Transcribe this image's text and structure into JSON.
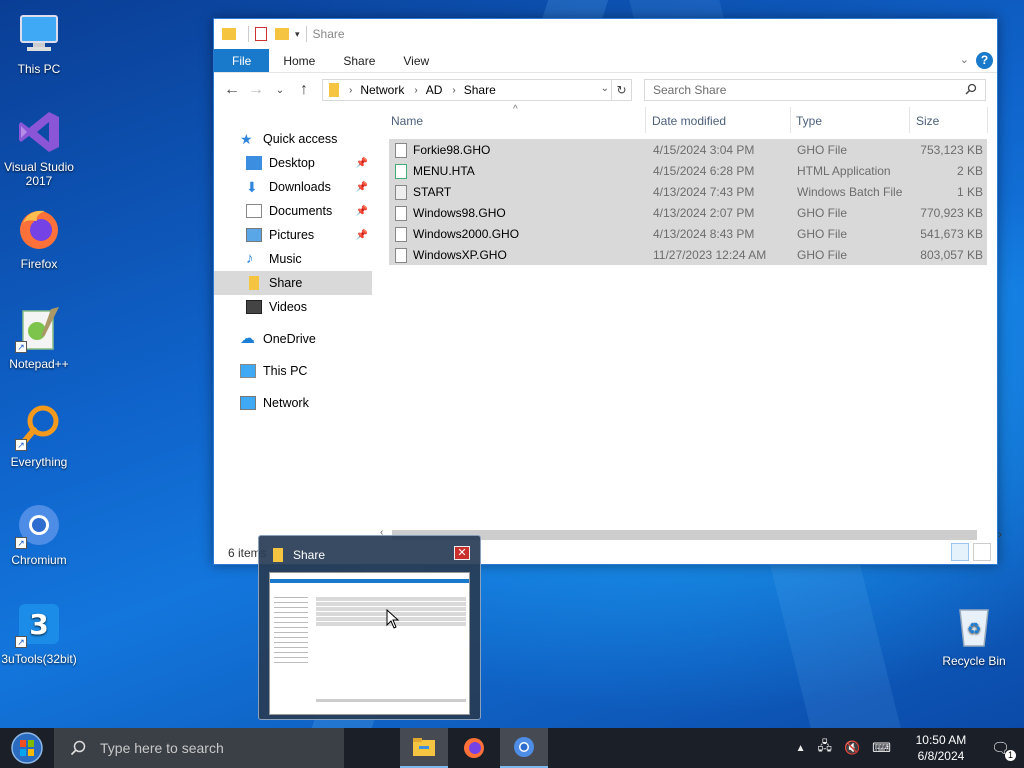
{
  "desktop": {
    "icons": [
      {
        "label": "This PC"
      },
      {
        "label": "Visual Studio 2017"
      },
      {
        "label": "Firefox"
      },
      {
        "label": "Notepad++"
      },
      {
        "label": "Everything"
      },
      {
        "label": "Chromium"
      },
      {
        "label": "3uTools(32bit)"
      },
      {
        "label": "Recycle Bin"
      }
    ]
  },
  "explorer": {
    "title": "Share",
    "ribbon_tabs": [
      "File",
      "Home",
      "Share",
      "View"
    ],
    "help": "?",
    "breadcrumbs": [
      "Network",
      "AD",
      "Share"
    ],
    "search_placeholder": "Search Share",
    "nav": {
      "quick_access": "Quick access",
      "desktop": "Desktop",
      "downloads": "Downloads",
      "documents": "Documents",
      "pictures": "Pictures",
      "music": "Music",
      "share": "Share",
      "videos": "Videos",
      "onedrive": "OneDrive",
      "this_pc": "This PC",
      "network": "Network"
    },
    "columns": {
      "name": "Name",
      "date": "Date modified",
      "type": "Type",
      "size": "Size"
    },
    "files": [
      {
        "name": "Forkie98.GHO",
        "date": "4/15/2024 3:04 PM",
        "type": "GHO File",
        "size": "753,123 KB"
      },
      {
        "name": "MENU.HTA",
        "date": "4/15/2024 6:28 PM",
        "type": "HTML Application",
        "size": "2 KB"
      },
      {
        "name": "START",
        "date": "4/13/2024 7:43 PM",
        "type": "Windows Batch File",
        "size": "1 KB"
      },
      {
        "name": "Windows98.GHO",
        "date": "4/13/2024 2:07 PM",
        "type": "GHO File",
        "size": "770,923 KB"
      },
      {
        "name": "Windows2000.GHO",
        "date": "4/13/2024 8:43 PM",
        "type": "GHO File",
        "size": "541,673 KB"
      },
      {
        "name": "WindowsXP.GHO",
        "date": "11/27/2023 12:24 AM",
        "type": "GHO File",
        "size": "803,057 KB"
      }
    ],
    "status": "6 items"
  },
  "preview": {
    "title": "Share",
    "close": "✕"
  },
  "taskbar": {
    "search_placeholder": "Type here to search",
    "time": "10:50 AM",
    "date": "6/8/2024",
    "notification_count": "1"
  }
}
